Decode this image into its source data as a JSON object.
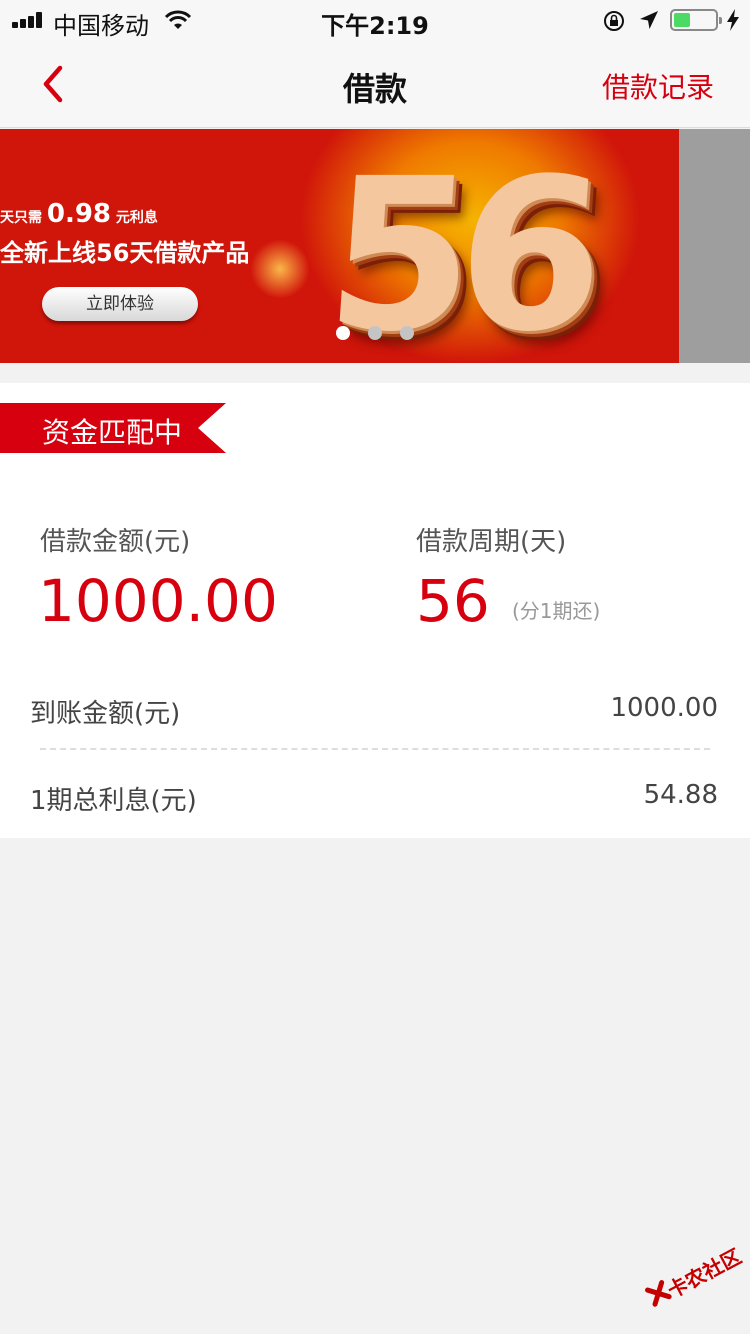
{
  "status_bar": {
    "carrier": "中国移动",
    "time": "下午2:19",
    "battery_level": 0.4
  },
  "nav": {
    "title": "借款",
    "records_label": "借款记录"
  },
  "banner": {
    "line1_prefix": "天只需",
    "line1_amount": "0.98",
    "line1_suffix": "元利息",
    "line2": "全新上线56天借款产品",
    "cta_label": "立即体验",
    "hero_number": "56",
    "active_slide": 0,
    "slide_count": 3
  },
  "loan": {
    "status": "资金匹配中",
    "amount_label": "借款金额(元)",
    "amount_value": "1000.00",
    "period_label": "借款周期(天)",
    "period_value": "56",
    "period_note": "(分1期还)",
    "received_label": "到账金额(元)",
    "received_value": "1000.00",
    "interest_label": "1期总利息(元)",
    "interest_value": "54.88"
  },
  "watermark": {
    "text": "卡农社区"
  },
  "colors": {
    "accent": "#d7000f",
    "page_bg": "#f2f2f2"
  }
}
